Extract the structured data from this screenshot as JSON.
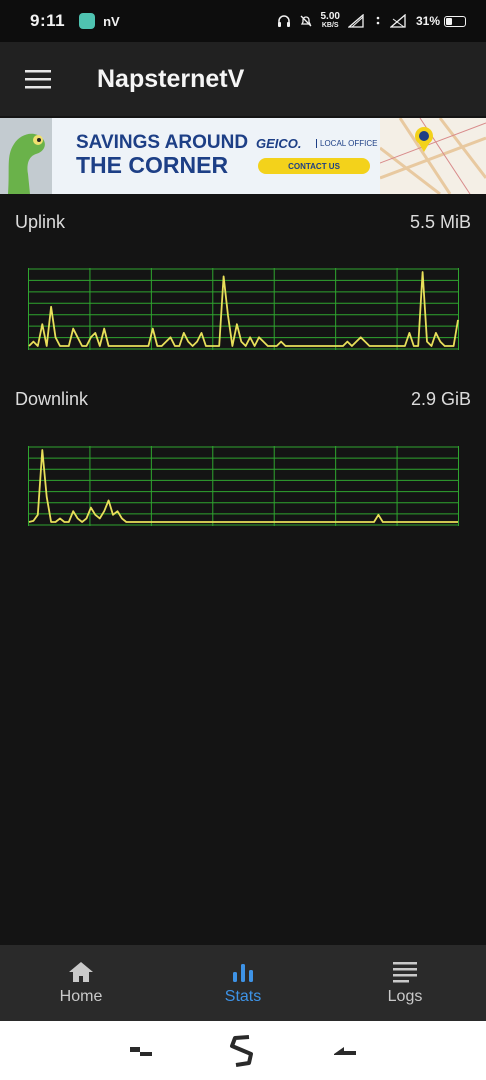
{
  "status_bar": {
    "time": "9:11",
    "notif_text": "nV",
    "speed_value": "5.00",
    "speed_unit": "KB/S",
    "battery": "31%",
    "battery_level": 0.31
  },
  "app_bar": {
    "title": "NapsternetV"
  },
  "ad": {
    "headline_1": "SAVINGS AROUND",
    "headline_2": "THE CORNER",
    "brand": "GEICO.",
    "office": "LOCAL OFFICE",
    "cta": "CONTACT US"
  },
  "uplink": {
    "label": "Uplink",
    "value": "5.5 MiB",
    "samples": [
      0,
      1,
      0,
      5,
      0,
      9,
      2,
      0,
      0,
      0,
      4,
      2,
      0,
      0,
      2,
      3,
      0,
      4,
      0,
      0,
      0,
      0,
      0,
      0,
      0,
      0,
      0,
      0,
      4,
      0,
      0,
      1,
      2,
      0,
      0,
      3,
      1,
      0,
      1,
      3,
      0,
      0,
      0,
      0,
      16,
      7,
      0,
      5,
      1,
      0,
      2,
      0,
      2,
      1,
      0,
      0,
      0,
      1,
      0,
      0,
      0,
      0,
      0,
      0,
      0,
      0,
      0,
      0,
      0,
      0,
      0,
      0,
      1,
      0,
      1,
      2,
      1,
      0,
      0,
      0,
      0,
      0,
      0,
      0,
      0,
      0,
      3,
      0,
      0,
      17,
      1,
      0,
      3,
      1,
      0,
      0,
      0,
      6
    ],
    "line_color": "#e8df5a",
    "grid_color": "#2fa52f"
  },
  "downlink": {
    "label": "Downlink",
    "value": "2.9 GiB",
    "samples": [
      0,
      0.3,
      2,
      20,
      7,
      0,
      0,
      1,
      0,
      0,
      3,
      1,
      0,
      1,
      4,
      2,
      1,
      3,
      6,
      2,
      3,
      1,
      0,
      0,
      0,
      0,
      0,
      0,
      0,
      0,
      0,
      0,
      0,
      0,
      0,
      0,
      0,
      0,
      0,
      0,
      0,
      0,
      0,
      0,
      0,
      0,
      0,
      0,
      0,
      0,
      0,
      0,
      0,
      0,
      0,
      0,
      0,
      0,
      0,
      0,
      0,
      0,
      0,
      0,
      0,
      0,
      0,
      0,
      0,
      0,
      0,
      0,
      0,
      0,
      0,
      0,
      0,
      0,
      0,
      2,
      0,
      0,
      0,
      0,
      0,
      0,
      0,
      0,
      0,
      0,
      0,
      0,
      0,
      0,
      0,
      0,
      0,
      0
    ],
    "line_color": "#e8df5a",
    "grid_color": "#2fa52f"
  },
  "bottom_nav": {
    "items": [
      {
        "label": "Home",
        "icon": "home-icon",
        "active": false
      },
      {
        "label": "Stats",
        "icon": "stats-icon",
        "active": true
      },
      {
        "label": "Logs",
        "icon": "logs-icon",
        "active": false
      }
    ]
  },
  "colors": {
    "accent": "#3e93e6",
    "background": "#141414",
    "app_bar": "#212121",
    "nav_bar": "#2a2a2a"
  }
}
